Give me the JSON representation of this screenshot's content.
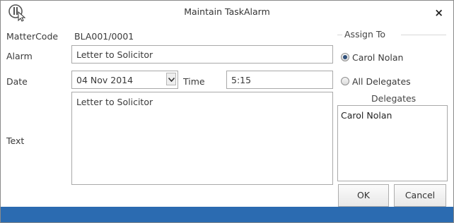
{
  "window": {
    "title": "Maintain TaskAlarm",
    "close_label": "×"
  },
  "form": {
    "matter_code_label": "MatterCode",
    "matter_code_value": "BLA001/0001",
    "alarm_label": "Alarm",
    "alarm_value": "Letter to Solicitor",
    "date_label": "Date",
    "date_value": "04 Nov 2014",
    "time_label": "Time",
    "time_value": "5:15",
    "text_label": "Text",
    "text_value": "Letter to Solicitor"
  },
  "assign_to": {
    "title": "Assign To",
    "options": [
      {
        "label": "Carol Nolan",
        "selected": true
      },
      {
        "label": "All Delegates",
        "selected": false
      }
    ]
  },
  "delegates": {
    "title": "Delegates",
    "items": [
      "Carol Nolan"
    ]
  },
  "buttons": {
    "ok": "OK",
    "cancel": "Cancel"
  },
  "colors": {
    "status_bar": "#2b6bb1",
    "radio_dot": "#2f4f7a"
  },
  "icons": {
    "app": "app-logo-icon",
    "close": "close-icon",
    "dropdown": "chevron-down-icon"
  }
}
